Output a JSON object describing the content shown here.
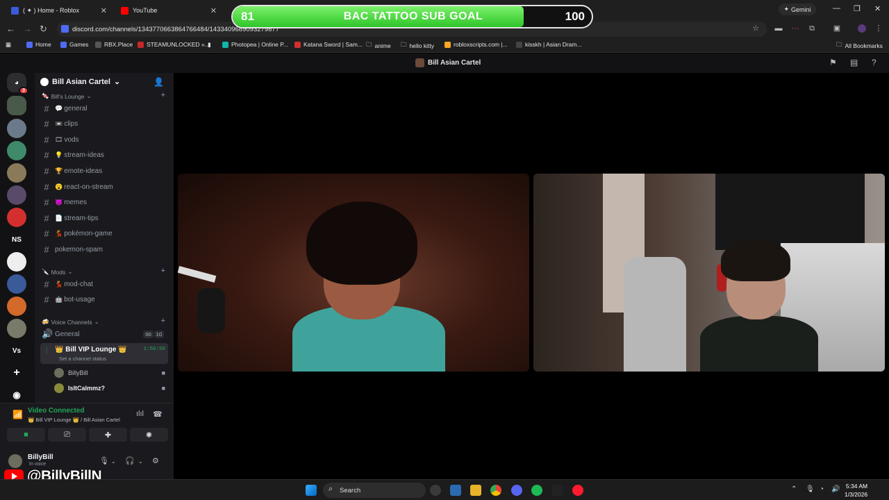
{
  "browser": {
    "tabs": [
      {
        "title": "( ✦ ) Home - Roblox",
        "color": "#3b5bdb"
      },
      {
        "title": "YouTube",
        "color": "#ff0000"
      }
    ],
    "gemini_label": "Gemini",
    "url": "discord.com/channels/1343770663864766484/1433409689093279877",
    "bookmarks": [
      {
        "label": "Home",
        "color": "#4f6bf6"
      },
      {
        "label": "Games",
        "color": "#4f6bf6"
      },
      {
        "label": "RBX.Place",
        "color": "#222"
      },
      {
        "label": "STEAMUNLOCKED »...",
        "color": "#c62828"
      },
      {
        "label": "Photopea | Online P...",
        "color": "#12b3a8"
      },
      {
        "label": "Katana Sword | Sam...",
        "color": "#d32f2f"
      },
      {
        "label": "anime",
        "color": "folder"
      },
      {
        "label": "hello kitty",
        "color": "folder"
      },
      {
        "label": "robloxscripts.com |...",
        "color": "#f9a825"
      },
      {
        "label": "kisskh | Asian Dram...",
        "color": "#444"
      }
    ],
    "all_bookmarks": "All Bookmarks"
  },
  "goal": {
    "current": "81",
    "title": "BAC TATTOO SUB GOAL",
    "target": "100",
    "progress": 0.81,
    "fill_color": "#3fd337"
  },
  "discord": {
    "top_title": "Bill Asian Cartel",
    "server_name": "Bill Asian Cartel",
    "guild_badge": "3",
    "guild_initials_ns": "NS",
    "guild_initials_vs": "Vs",
    "categories": {
      "lounge": "Bill's Lounge",
      "mods": "Mods",
      "voice": "Voice Channels"
    },
    "text_channels": [
      {
        "emoji": "💬",
        "name": "general"
      },
      {
        "emoji": "📼",
        "name": "clips"
      },
      {
        "emoji": "🎞",
        "name": "vods"
      },
      {
        "emoji": "💡",
        "name": "stream-ideas"
      },
      {
        "emoji": "🏆",
        "name": "emote-ideas"
      },
      {
        "emoji": "😮",
        "name": "react-on-stream"
      },
      {
        "emoji": "😈",
        "name": "memes"
      },
      {
        "emoji": "📄",
        "name": "stream-tips"
      },
      {
        "emoji": "💃",
        "name": "pokémon-game"
      },
      {
        "emoji": "",
        "name": "pokemon-spam"
      }
    ],
    "mod_channels": [
      {
        "emoji": "💃",
        "name": "mod-chat"
      },
      {
        "emoji": "🤖",
        "name": "bot-usage"
      }
    ],
    "voice_channels": [
      {
        "name": "General",
        "count_a": "00",
        "count_b": "10"
      },
      {
        "name": "👑 Bill VIP Lounge 👑",
        "timer": "1:56:50",
        "status": "Set a channel status"
      }
    ],
    "voice_members": [
      {
        "name": "BillyBill",
        "bold": false
      },
      {
        "name": "IsItCalmmz?",
        "bold": true
      }
    ],
    "voice_connection": {
      "title": "Video Connected",
      "subtitle": "👑 Bill VIP Lounge 👑 / Bill Asian Cartel"
    },
    "user": {
      "name": "BillyBill",
      "status": "In voice"
    }
  },
  "overlay": {
    "youtube_handle": "@BillyBillN"
  },
  "taskbar": {
    "search_placeholder": "Search",
    "time": "5:34 AM",
    "date": "1/3/2026"
  }
}
